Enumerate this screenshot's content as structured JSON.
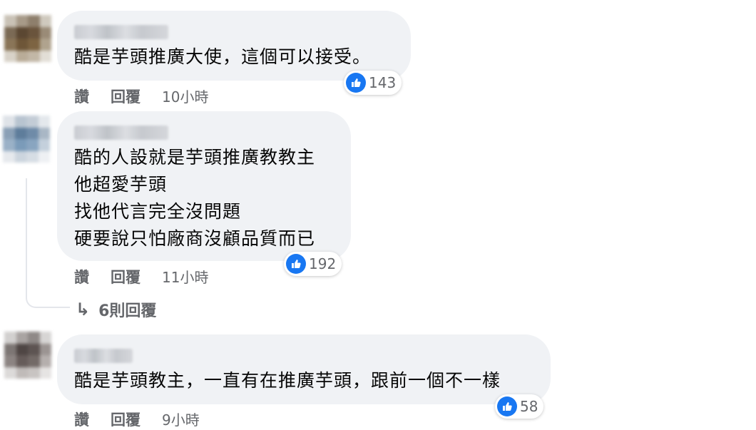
{
  "comments": [
    {
      "author": "",
      "text": "酷是芋頭推廣大使，這個可以接受。",
      "like_count": "143",
      "actions": {
        "like": "讚",
        "reply": "回覆"
      },
      "time": "10小時"
    },
    {
      "author": "",
      "text": "酷的人設就是芋頭推廣教教主\n他超愛芋頭\n找他代言完全沒問題\n硬要說只怕廠商沒顧品質而已",
      "like_count": "192",
      "actions": {
        "like": "讚",
        "reply": "回覆"
      },
      "time": "11小時",
      "view_replies": "6則回覆"
    },
    {
      "author": "",
      "text": "酷是芋頭教主，一直有在推廣芋頭，跟前一個不一樣",
      "like_count": "58",
      "actions": {
        "like": "讚",
        "reply": "回覆"
      },
      "time": "9小時"
    }
  ],
  "colors": {
    "bubble_bg": "#f0f2f5",
    "like_blue": "#1877f2",
    "secondary_text": "#65676b"
  },
  "icons": {
    "like": "thumbs-up-icon",
    "reply_arrow": "reply-arrow-icon"
  }
}
